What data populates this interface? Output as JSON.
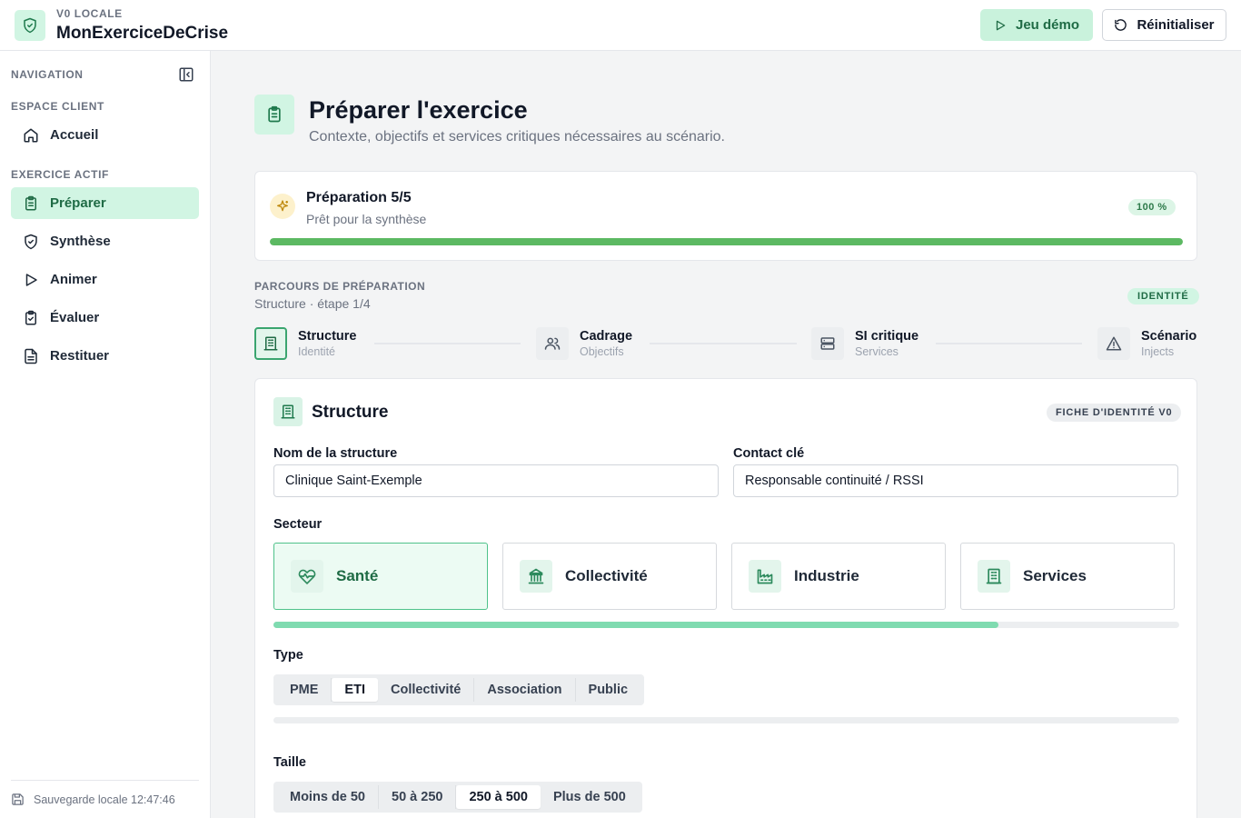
{
  "header": {
    "subtitle": "V0 LOCALE",
    "title": "MonExerciceDeCrise",
    "demo_label": "Jeu démo",
    "reset_label": "Réinitialiser"
  },
  "sidebar": {
    "nav_heading": "NAVIGATION",
    "section_client": "ESPACE CLIENT",
    "home_label": "Accueil",
    "section_active": "EXERCICE ACTIF",
    "items": [
      {
        "label": "Préparer",
        "icon": "clipboard-icon",
        "active": true
      },
      {
        "label": "Synthèse",
        "icon": "shield-check-icon"
      },
      {
        "label": "Animer",
        "icon": "play-icon"
      },
      {
        "label": "Évaluer",
        "icon": "clipboard-check-icon"
      },
      {
        "label": "Restituer",
        "icon": "document-icon"
      }
    ],
    "footer": "Sauvegarde locale 12:47:46"
  },
  "page": {
    "title": "Préparer l'exercice",
    "subtitle": "Contexte, objectifs et services critiques nécessaires au scénario."
  },
  "progress": {
    "title": "Préparation 5/5",
    "subtitle": "Prêt pour la synthèse",
    "percent_label": "100 %",
    "value": 1.0
  },
  "journey": {
    "label": "PARCOURS DE PRÉPARATION",
    "sub": "Structure · étape 1/4",
    "badge": "IDENTITÉ",
    "steps": [
      {
        "title": "Structure",
        "sub": "Identité",
        "icon": "building-icon"
      },
      {
        "title": "Cadrage",
        "sub": "Objectifs",
        "icon": "users-icon"
      },
      {
        "title": "SI critique",
        "sub": "Services",
        "icon": "server-icon"
      },
      {
        "title": "Scénario",
        "sub": "Injects",
        "icon": "warning-icon"
      }
    ]
  },
  "form": {
    "title": "Structure",
    "badge": "FICHE D'IDENTITÉ V0",
    "name_label": "Nom de la structure",
    "name_value": "Clinique Saint-Exemple",
    "contact_label": "Contact clé",
    "contact_value": "Responsable continuité / RSSI",
    "sector_label": "Secteur",
    "sectors": [
      {
        "label": "Santé",
        "icon": "heart-pulse-icon"
      },
      {
        "label": "Collectivité",
        "icon": "landmark-icon"
      },
      {
        "label": "Industrie",
        "icon": "factory-icon"
      },
      {
        "label": "Services",
        "icon": "building-icon"
      }
    ],
    "sector_scroll": 0.8,
    "type_label": "Type",
    "types": [
      "PME",
      "ETI",
      "Collectivité",
      "Association",
      "Public"
    ],
    "type_selected": "ETI",
    "size_label": "Taille",
    "sizes": [
      "Moins de 50",
      "50 à 250",
      "250 à 500",
      "Plus de 500"
    ],
    "size_selected": "250 à 500"
  },
  "colors": {
    "accent": "#1f6b45",
    "accent_bg": "#d1f5e3",
    "progress": "#5cb962"
  }
}
